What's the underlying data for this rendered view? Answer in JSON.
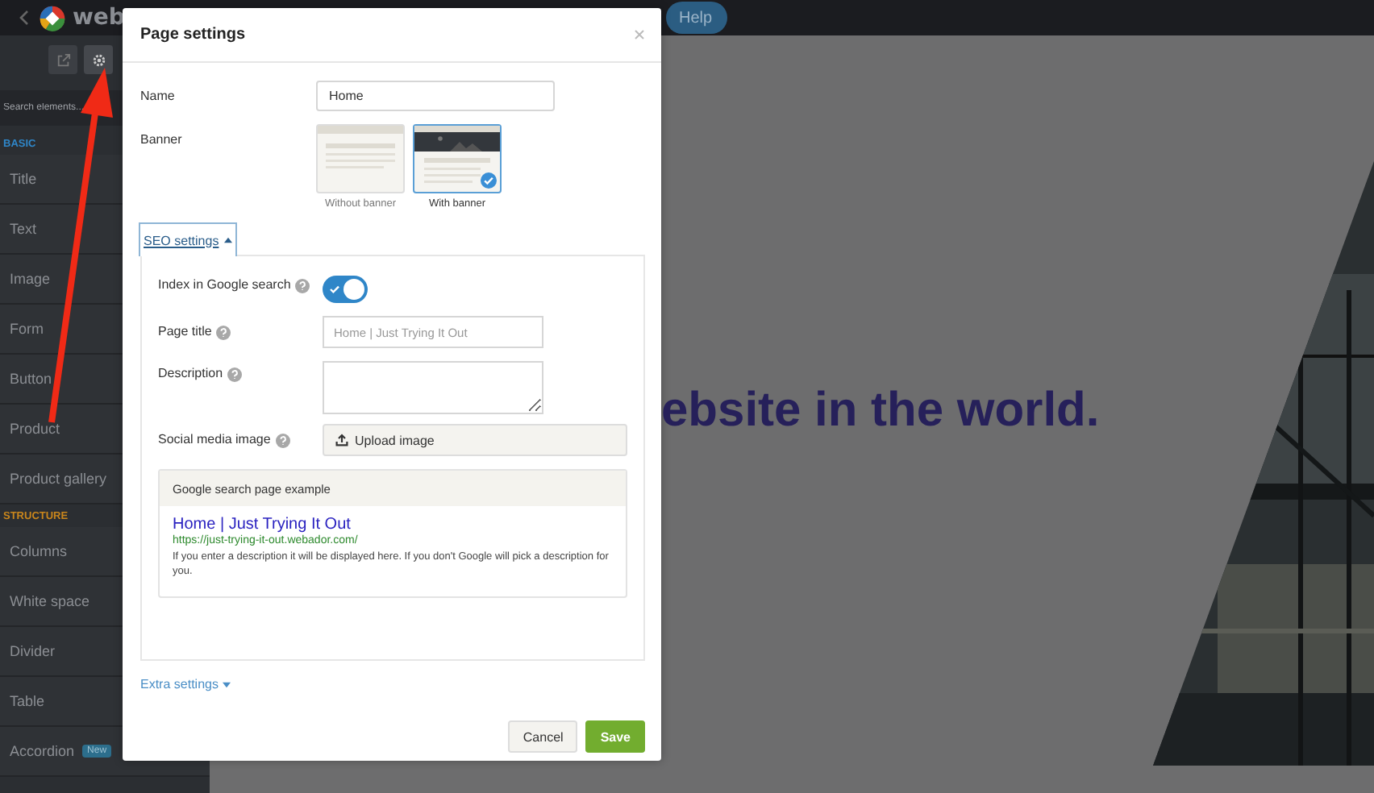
{
  "top_bar": {
    "logo": "web",
    "help_button": "Help"
  },
  "sidebar": {
    "search": {
      "placeholder": "Search elements..."
    },
    "sections": [
      {
        "title": "BASIC",
        "color": "#2f86c8",
        "items": [
          {
            "label": "Title"
          },
          {
            "label": "Text"
          },
          {
            "label": "Image"
          },
          {
            "label": "Form"
          },
          {
            "label": "Button"
          },
          {
            "label": "Product"
          },
          {
            "label": "Product gallery"
          }
        ]
      },
      {
        "title": "STRUCTURE",
        "color": "#c9861c",
        "items": [
          {
            "label": "Columns"
          },
          {
            "label": "White space"
          },
          {
            "label": "Divider"
          },
          {
            "label": "Table"
          },
          {
            "label": "Accordion",
            "badge": "New"
          }
        ]
      }
    ]
  },
  "canvas": {
    "heading": "ebsite in the world."
  },
  "dialog": {
    "title": "Page settings",
    "name": {
      "label": "Name",
      "value": "Home"
    },
    "banner": {
      "label": "Banner",
      "options": [
        {
          "label": "Without banner",
          "selected": false,
          "kind": "plain"
        },
        {
          "label": "With banner",
          "selected": true,
          "kind": "banner"
        }
      ]
    },
    "seo": {
      "toggle": "SEO settings",
      "expanded": true,
      "index": {
        "label": "Index in Google search",
        "on": true
      },
      "page_title": {
        "label": "Page title",
        "placeholder": "Home | Just Trying It Out"
      },
      "description": {
        "label": "Description"
      },
      "social_image": {
        "label": "Social media image",
        "button": "Upload image"
      },
      "preview": {
        "header": "Google search page example",
        "title": "Home | Just Trying It Out",
        "url": "https://just-trying-it-out.webador.com/",
        "text": "If you enter a description it will be displayed here. If you don't Google will pick a description for you."
      }
    },
    "extra_settings": {
      "toggle": "Extra settings",
      "expanded": false
    },
    "buttons": [
      {
        "label": "Cancel",
        "kind": "secondary"
      },
      {
        "label": "Save",
        "kind": "primary"
      }
    ]
  }
}
